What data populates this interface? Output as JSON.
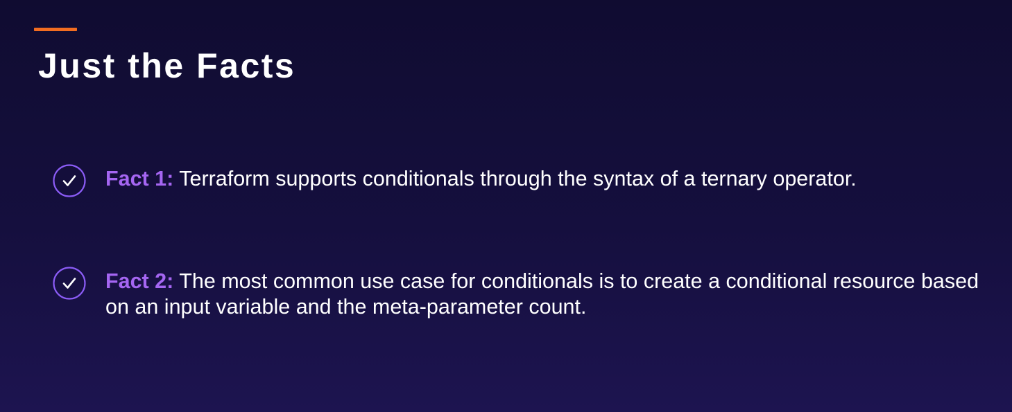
{
  "slide": {
    "title": "Just the Facts",
    "facts": [
      {
        "icon": "check-circle-icon",
        "label": "Fact 1:",
        "text": "Terraform supports conditionals through the syntax of a ternary operator."
      },
      {
        "icon": "check-circle-icon",
        "label": "Fact 2:",
        "text": "The most common use case for conditionals is to create a conditional resource based on an input variable and the meta-parameter count."
      }
    ]
  },
  "colors": {
    "background": "#130e39",
    "accent_bar": "#f26d21",
    "fact_label": "#a566f2",
    "check_icon": "#8b5cf6",
    "text": "#ffffff"
  }
}
